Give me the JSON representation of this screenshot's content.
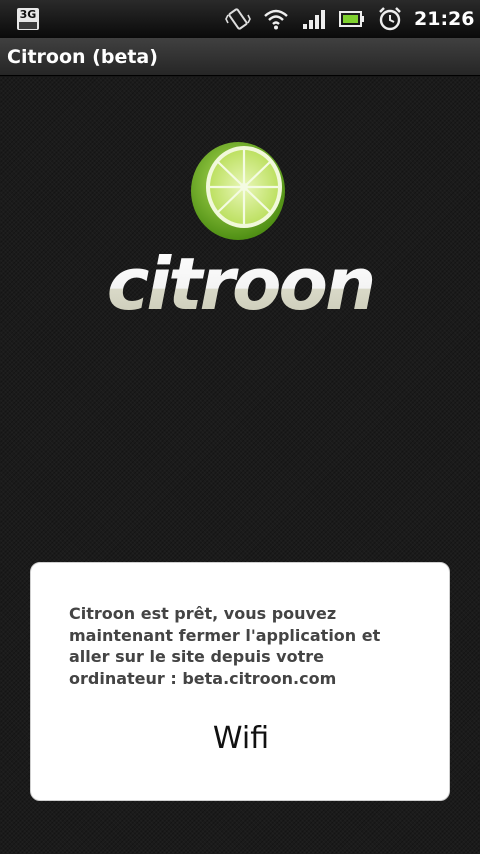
{
  "status_bar": {
    "network_label": "3G",
    "icons": [
      "3g-icon",
      "vibrate-icon",
      "wifi-icon",
      "signal-icon",
      "battery-icon",
      "alarm-icon"
    ],
    "time": "21:26"
  },
  "title_bar": {
    "title": "Citroon (beta)"
  },
  "logo": {
    "wordmark": "citroon",
    "lime_color": "#8dc63f",
    "wordmark_color": "#ffffff"
  },
  "dialog": {
    "message": "Citroon est prêt, vous pouvez maintenant fermer l'application et aller sur le site depuis votre ordinateur : beta.citroon.com",
    "connection_label": "Wifi"
  },
  "colors": {
    "background": "#1b1b1b",
    "dialog_background": "#ffffff",
    "message_text": "#444444"
  }
}
